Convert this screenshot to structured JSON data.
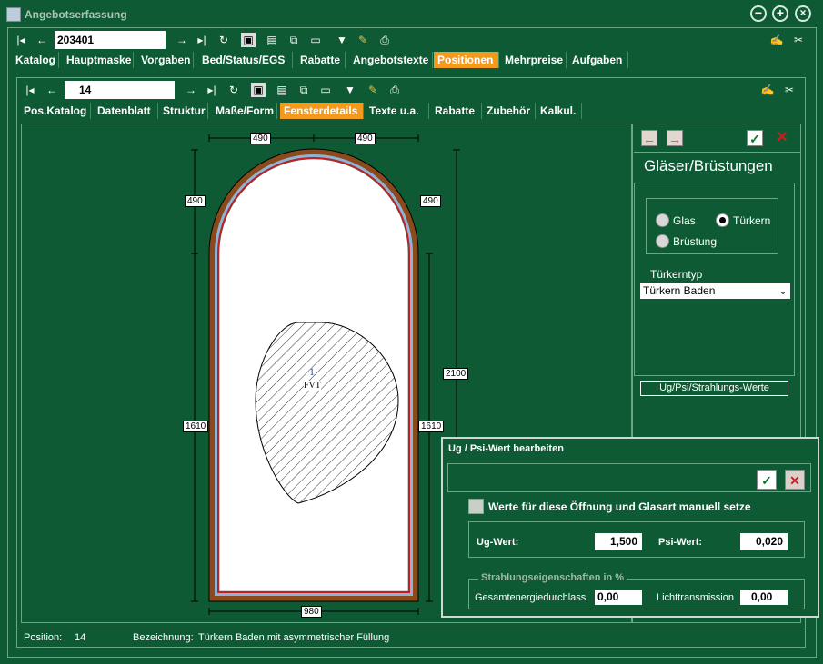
{
  "window": {
    "title": "Angebotserfassung"
  },
  "toolbar1": {
    "record_value": "203401"
  },
  "main_tabs": [
    "Katalog",
    "Hauptmaske",
    "Vorgaben",
    "Bed/Status/EGS",
    "Rabatte",
    "Angebotstexte",
    "Positionen",
    "Mehrpreise",
    "Aufgaben"
  ],
  "toolbar2": {
    "record_value": "14"
  },
  "sub_tabs": [
    "Pos.Katalog",
    "Datenblatt",
    "Struktur",
    "Maße/Form",
    "Fensterdetails",
    "Texte u.a.",
    "Rabatte",
    "Zubehör",
    "Kalkul."
  ],
  "drawing": {
    "dims": {
      "top_left": "490",
      "top_right": "490",
      "left_upper": "490",
      "right_upper": "490",
      "right_total": "2100",
      "left_lower": "1610",
      "right_lower": "1610",
      "bottom": "980"
    },
    "fill_number": "1",
    "fill_code": "FVT"
  },
  "glaeser_panel": {
    "title": "Gläser/Brüstungen",
    "radio_glas": "Glas",
    "radio_tuerkern": "Türkern",
    "radio_bruestung": "Brüstung",
    "selected": "Türkern",
    "tuerkern_typ_label": "Türkerntyp",
    "tuerkern_typ_value": "Türkern Baden",
    "ug_button": "Ug/Psi/Strahlungs-Werte"
  },
  "ug_dialog": {
    "title": "Ug / Psi-Wert bearbeiten",
    "checkbox_label": "Werte für diese Öffnung und Glasart manuell setze",
    "ug_label": "Ug-Wert:",
    "ug_value": "1,500",
    "psi_label": "Psi-Wert:",
    "psi_value": "0,020",
    "strahlung_legend": "Strahlungseigenschaften in %",
    "gesamt_label": "Gesamtenergiedurchlass",
    "gesamt_value": "0,00",
    "licht_label": "Lichttransmission",
    "licht_value": "0,00"
  },
  "status": {
    "position_label": "Position:",
    "position_value": "14",
    "bezeichnung_label": "Bezeichnung:",
    "bezeichnung_value": "Türkern Baden mit asymmetrischer Füllung"
  },
  "colors": {
    "background": "#0e5a34",
    "active_tab": "#f39a1e",
    "frame_brown": "#8b4a1c",
    "frame_blue": "#8fb3d6",
    "frame_red": "#c41e1e"
  }
}
